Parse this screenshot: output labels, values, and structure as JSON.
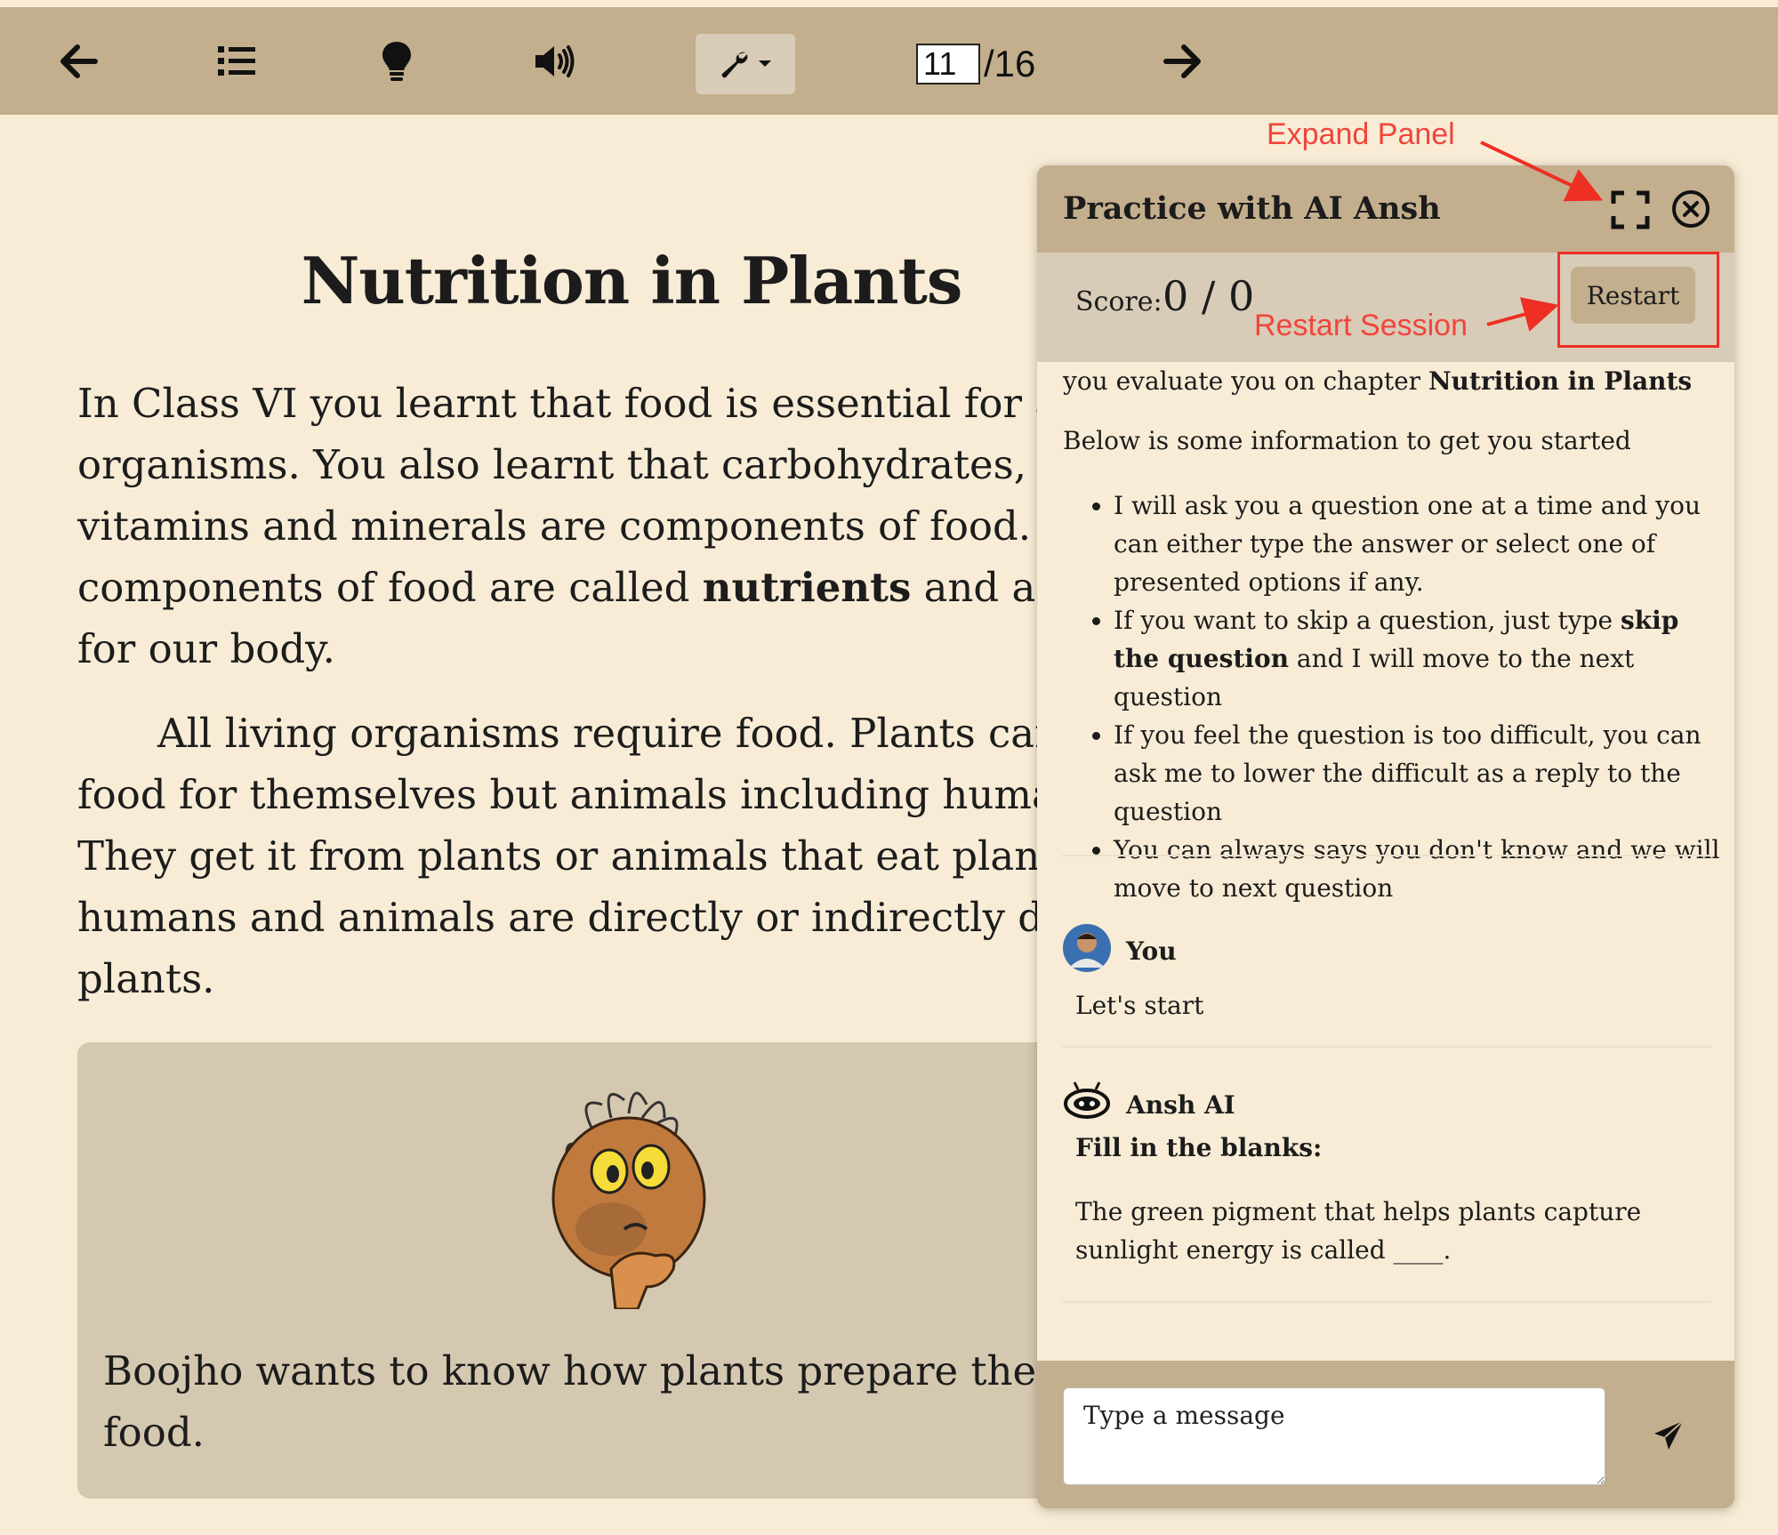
{
  "toolbar": {
    "page_current": "11",
    "page_total": "/16",
    "icons": [
      "arrow-left-icon",
      "list-icon",
      "lightbulb-icon",
      "volume-icon",
      "wrench-icon",
      "arrow-right-icon"
    ]
  },
  "book": {
    "chapter_title": "Nutrition in Plants",
    "para1_a": "In Class VI you learnt that food is essential for all living organisms. You also learnt that carbohydrates, proteins, fats, vitamins and minerals are components of food. These components of food are called ",
    "para1_bold": "nutrients",
    "para1_b": " and are necessary for our body.",
    "para2": "All living organisms require food. Plants can synthesise food for themselves but animals including humans cannot. They get it from plants or animals that eat plants. Thus, humans and animals are directly or indirectly dependent on plants.",
    "callout_text": "Boojho wants to know how plants prepare their own food."
  },
  "panel": {
    "title": "Practice with AI Ansh",
    "score_label": "Score:",
    "score_value": "0 / 0",
    "restart_label": "Restart",
    "intro_a": "you evaluate you on chapter ",
    "intro_bold": "Nutrition in Plants",
    "intro2": "Below is some information to get you started",
    "rule1": "I will ask you a question one at a time and you can either type the answer or select one of presented options if any.",
    "rule2_a": "If you want to skip a question, just type ",
    "rule2_bold": "skip the question",
    "rule2_b": " and I will move to the next question",
    "rule3": "If you feel the question is too difficult, you can ask me to lower the difficult as a reply to the question",
    "rule4": "You can always says you don't know and we will move to next question",
    "user_name": "You",
    "user_msg": "Let's start",
    "ai_name": "Ansh AI",
    "ai_heading": "Fill in the blanks:",
    "ai_question": "The green pigment that helps plants capture sunlight energy is called ____.",
    "input_placeholder": "Type a message"
  },
  "annotations": {
    "expand_label": "Expand Panel",
    "restart_label": "Restart Session",
    "color": "#f1453b"
  },
  "colors": {
    "toolbar_bg": "#c3af8d",
    "page_bg": "#f8ecd6",
    "score_bar_bg": "#d8ccb8",
    "callout_bg": "#d5c8b0"
  }
}
